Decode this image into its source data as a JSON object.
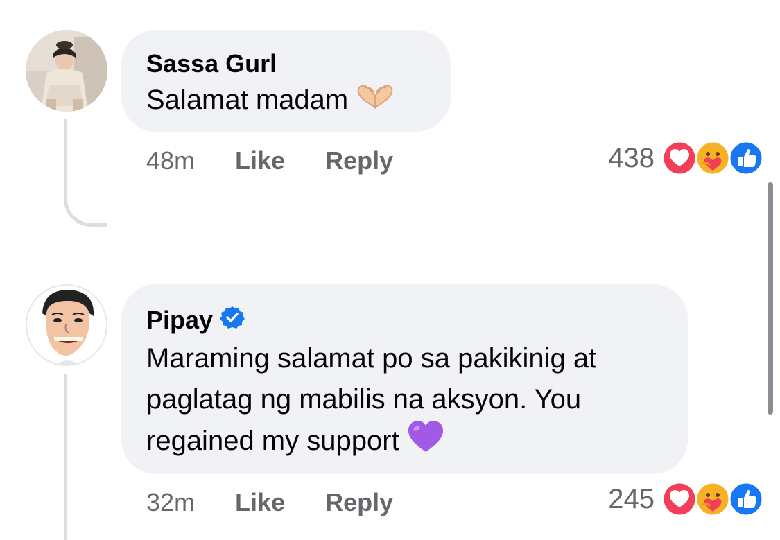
{
  "comments": [
    {
      "author": "Sassa Gurl",
      "text": "Salamat madam",
      "emoji": "heart-hands",
      "time": "48m",
      "like_label": "Like",
      "reply_label": "Reply",
      "reaction_count": "438",
      "reactions": [
        "love",
        "care",
        "like"
      ],
      "verified": false
    },
    {
      "author": "Pipay",
      "text": "Maraming salamat po sa pakikinig at paglatag ng mabilis na aksyon. You regained my support",
      "emoji": "purple-heart",
      "time": "32m",
      "like_label": "Like",
      "reply_label": "Reply",
      "reaction_count": "245",
      "reactions": [
        "love",
        "care",
        "like"
      ],
      "verified": true
    }
  ],
  "colors": {
    "bubble": "#f0f2f5",
    "meta": "#65676b",
    "love": "#f33e58",
    "like": "#1877f2",
    "care": "#f7b125",
    "verified": "#1877f2",
    "thread_line": "#dadde1",
    "purple_heart": "#a259e6"
  }
}
